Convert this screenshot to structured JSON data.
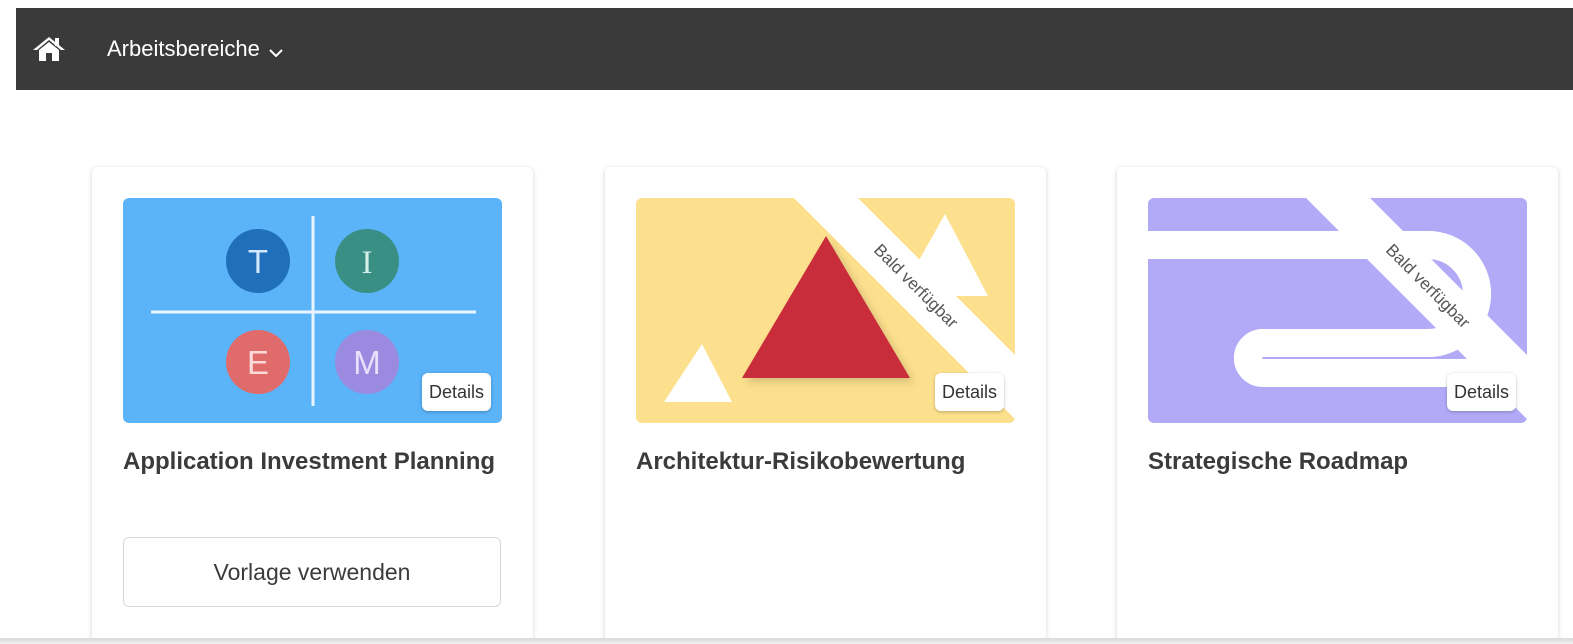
{
  "topbar": {
    "home_icon": "home-icon",
    "workspaces_label": "Arbeitsbereiche",
    "chevron_icon": "chevron-down-icon"
  },
  "cards": [
    {
      "title": "Application Investment Planning",
      "details_label": "Details",
      "use_template_label": "Vorlage verwenden",
      "thumbnail": {
        "background": "#5bb3f8",
        "letters": [
          "T",
          "I",
          "E",
          "M"
        ],
        "colors": [
          "#1f6fbb",
          "#3a8f85",
          "#e06b6b",
          "#9b8be0"
        ]
      }
    },
    {
      "title": "Architektur-Risikobewertung",
      "details_label": "Details",
      "ribbon_label": "Bald verfügbar",
      "thumbnail": {
        "background": "#fce08d",
        "accent": "#c92c3a"
      }
    },
    {
      "title": "Strategische Roadmap",
      "details_label": "Details",
      "ribbon_label": "Bald verfügbar",
      "thumbnail": {
        "background": "#b3aaf7"
      }
    }
  ]
}
